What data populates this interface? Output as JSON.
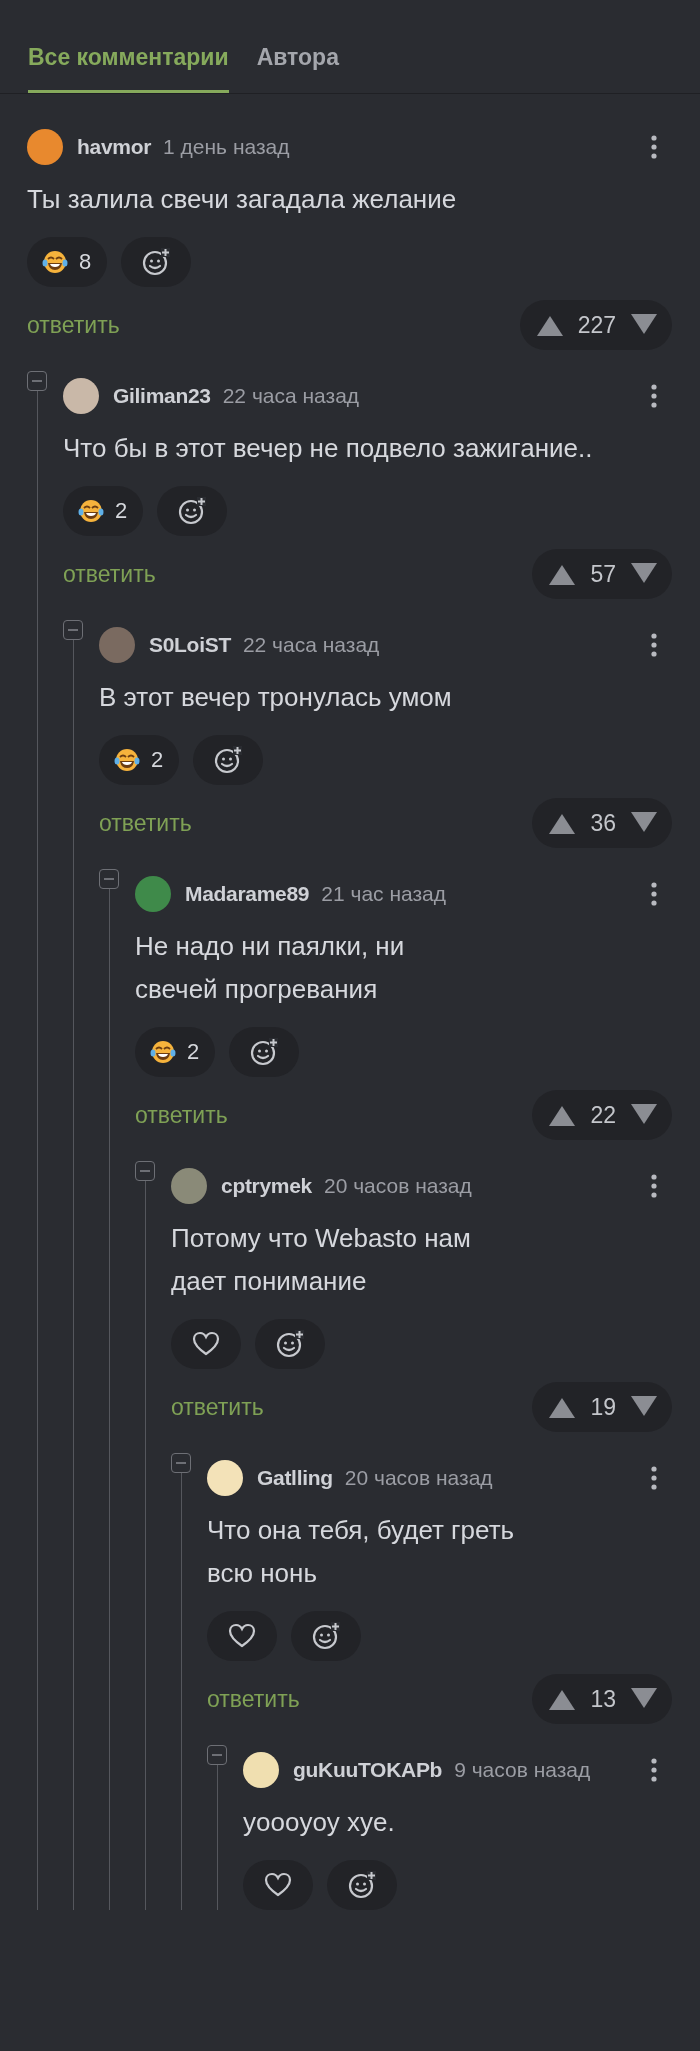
{
  "tabs": [
    {
      "label": "Все комментарии",
      "selected": true
    },
    {
      "label": "Автора",
      "selected": false
    }
  ],
  "comments": [
    {
      "author": "havmor",
      "time": "1 день назад",
      "avatar": {
        "color": "#e8892e"
      },
      "text": "Ты залила свечи загадала желание",
      "reactions": [
        {
          "kind": "laugh",
          "count": "8"
        },
        {
          "kind": "add"
        }
      ],
      "reply": "ответить",
      "votes": "227",
      "children": [
        {
          "author": "Giliman23",
          "time": "22 часа назад",
          "avatar": {
            "color": "#c9b8a8"
          },
          "text": "Что бы в этот вечер не подвело зажигание..",
          "reactions": [
            {
              "kind": "laugh",
              "count": "2"
            },
            {
              "kind": "add"
            }
          ],
          "reply": "ответить",
          "votes": "57",
          "children": [
            {
              "author": "S0LoiST",
              "time": "22 часа назад",
              "avatar": {
                "color": "#7a6a60"
              },
              "text": "В этот вечер тронулась умом",
              "reactions": [
                {
                  "kind": "laugh",
                  "count": "2"
                },
                {
                  "kind": "add"
                }
              ],
              "reply": "ответить",
              "votes": "36",
              "children": [
                {
                  "author": "Madarame89",
                  "time": "21 час назад",
                  "avatar": {
                    "color": "#3f8a4a"
                  },
                  "text": "Не надо ни паялки, ни\nсвечей прогревания",
                  "reactions": [
                    {
                      "kind": "laugh",
                      "count": "2"
                    },
                    {
                      "kind": "add"
                    }
                  ],
                  "reply": "ответить",
                  "votes": "22",
                  "children": [
                    {
                      "author": "cptrymek",
                      "time": "20 часов назад",
                      "avatar": {
                        "color": "#8a8a78"
                      },
                      "text": "Потому что Webasto нам\nдает понимание",
                      "reactions": [
                        {
                          "kind": "like"
                        },
                        {
                          "kind": "add"
                        }
                      ],
                      "reply": "ответить",
                      "votes": "19",
                      "children": [
                        {
                          "author": "Gatlling",
                          "time": "20 часов назад",
                          "avatar": {
                            "color": "#f3e2b8"
                          },
                          "text": "Что она тебя, будет греть\nвсю нонь",
                          "reactions": [
                            {
                              "kind": "like"
                            },
                            {
                              "kind": "add"
                            }
                          ],
                          "reply": "ответить",
                          "votes": "13",
                          "children": [
                            {
                              "author": "guKuuTOKAPb",
                              "time": "9 часов назад",
                              "avatar": {
                                "color": "#f0dfb0"
                              },
                              "text": "yoooyoy xye.",
                              "reactions": [
                                {
                                  "kind": "like"
                                },
                                {
                                  "kind": "add"
                                }
                              ]
                            }
                          ]
                        }
                      ]
                    }
                  ]
                }
              ]
            }
          ]
        }
      ]
    }
  ]
}
